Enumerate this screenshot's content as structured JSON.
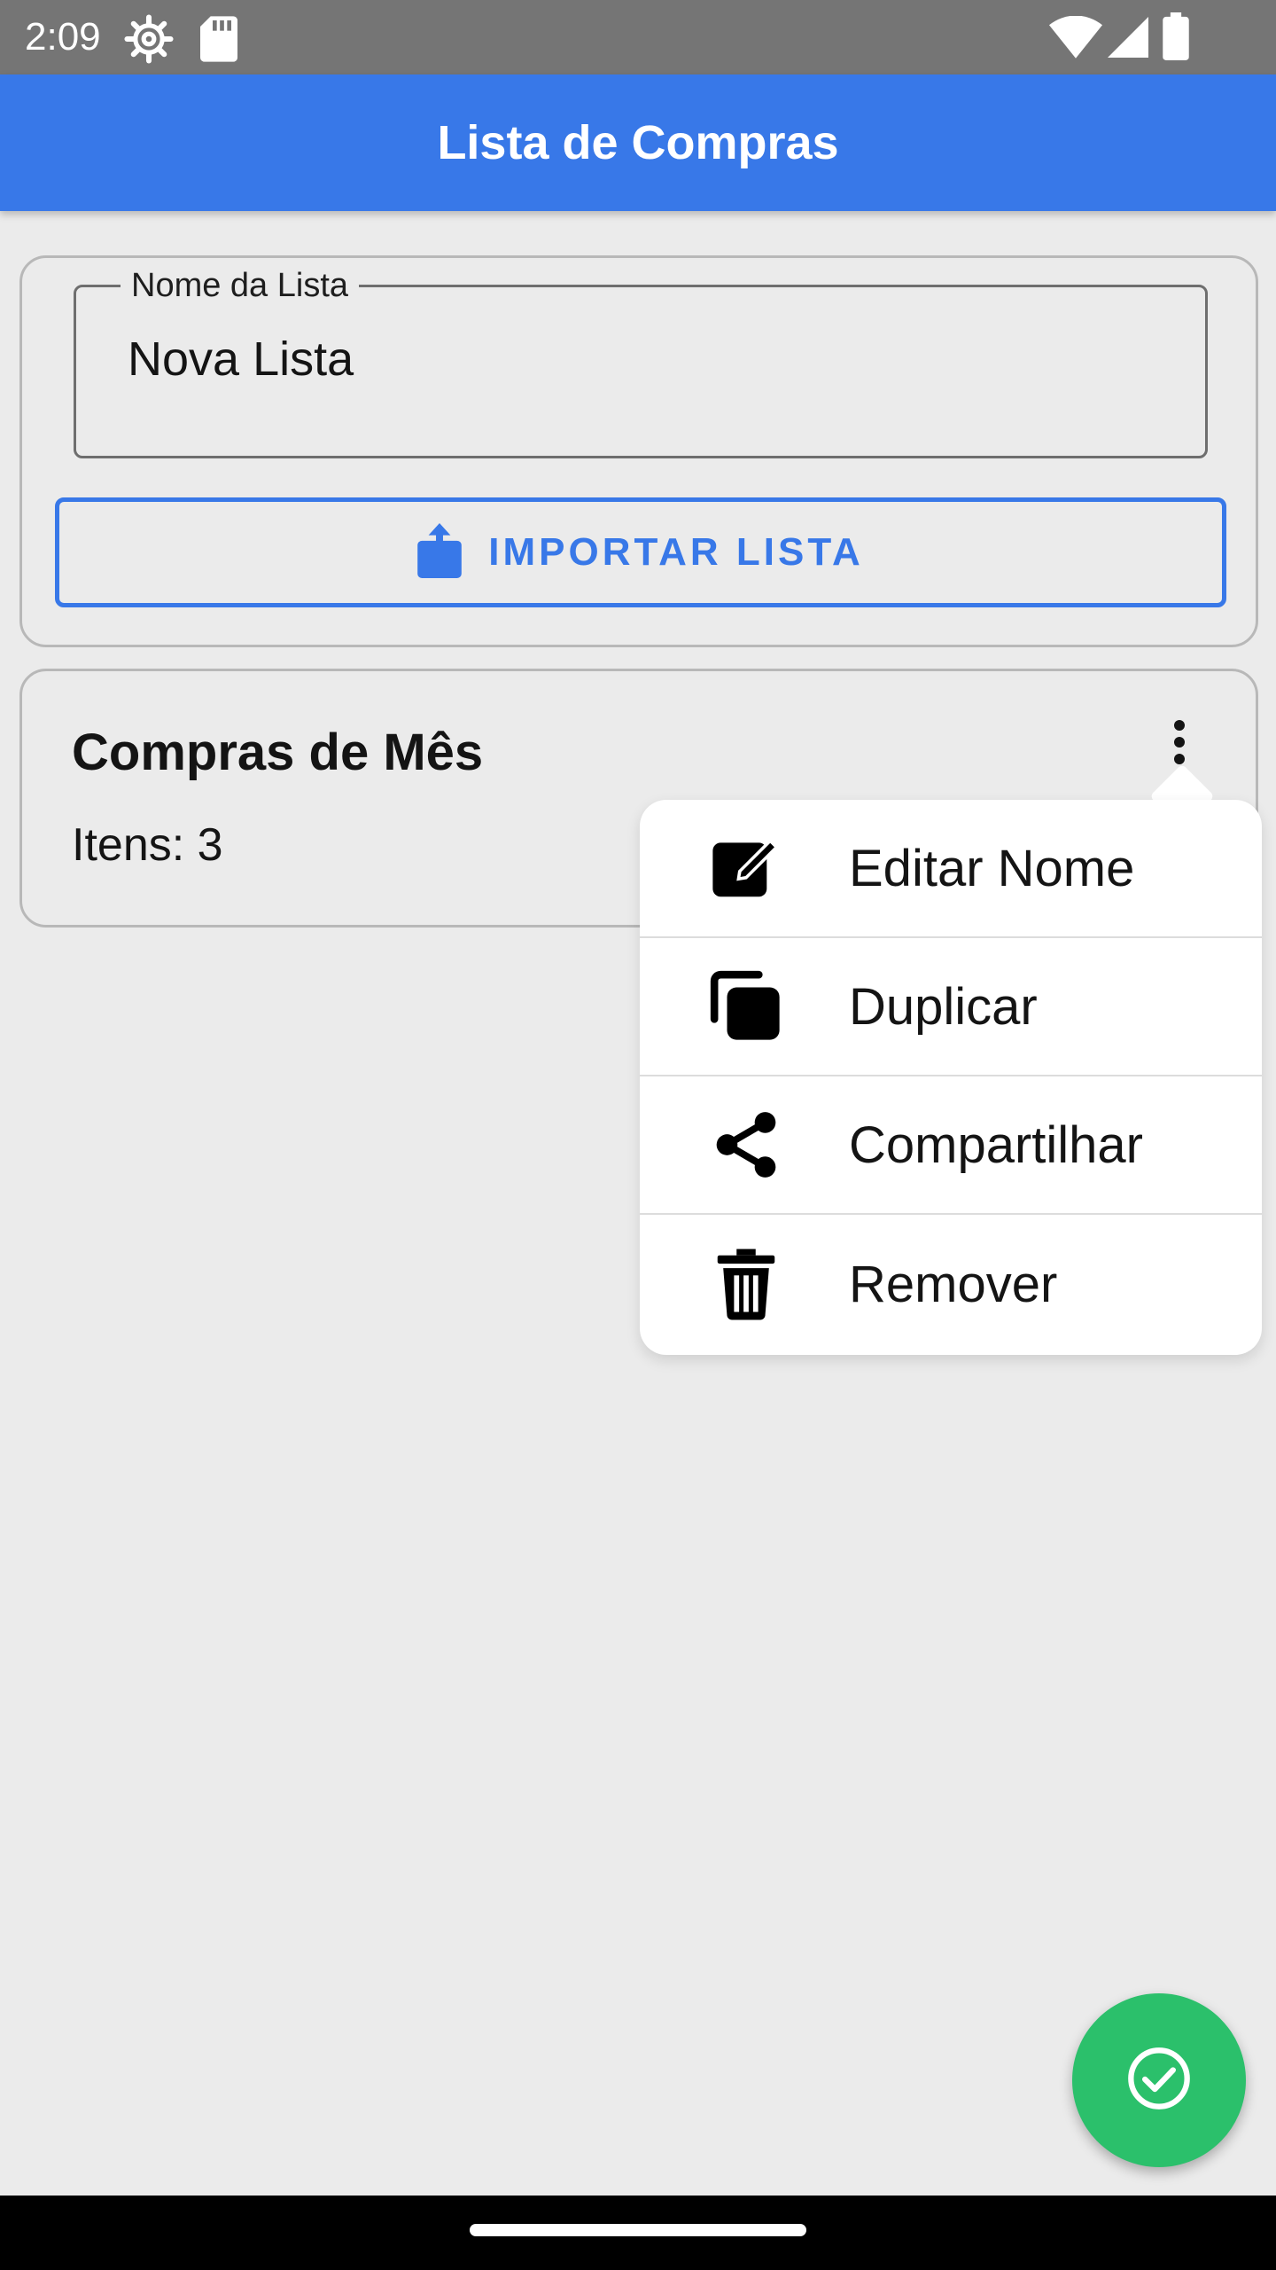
{
  "status_bar": {
    "time": "2:09",
    "icons": [
      "settings-gear-icon",
      "sd-card-icon",
      "wifi-icon",
      "cell-signal-icon",
      "battery-icon"
    ]
  },
  "app_bar": {
    "title": "Lista de Compras",
    "color": "#3878e8"
  },
  "form": {
    "name_label": "Nome da Lista",
    "name_value": "Nova Lista",
    "import_button_label": "IMPORTAR LISTA",
    "import_icon": "share-upload-icon"
  },
  "list_card": {
    "title": "Compras de Mês",
    "count_text": "Itens: 3",
    "overflow_icon": "more-vert-icon"
  },
  "menu": {
    "items": [
      {
        "label": "Editar Nome",
        "icon": "edit-icon"
      },
      {
        "label": "Duplicar",
        "icon": "duplicate-icon"
      },
      {
        "label": "Compartilhar",
        "icon": "share-icon"
      },
      {
        "label": "Remover",
        "icon": "trash-icon"
      }
    ]
  },
  "fab": {
    "icon": "check-circle-icon",
    "color": "#2bc06b"
  }
}
